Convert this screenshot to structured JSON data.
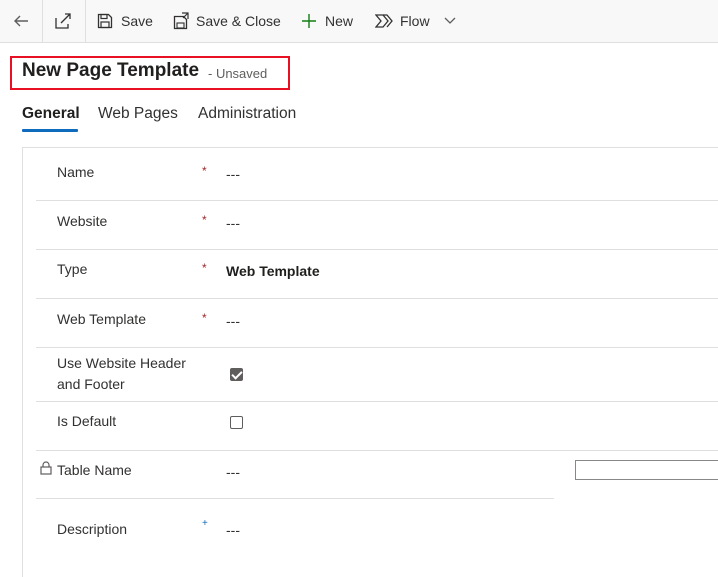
{
  "toolbar": {
    "save_label": "Save",
    "save_close_label": "Save & Close",
    "new_label": "New",
    "flow_label": "Flow"
  },
  "header": {
    "title": "New Page Template",
    "status": "- Unsaved"
  },
  "tabs": [
    {
      "label": "General",
      "active": true
    },
    {
      "label": "Web Pages",
      "active": false
    },
    {
      "label": "Administration",
      "active": false
    }
  ],
  "form": {
    "name": {
      "label": "Name",
      "required": "*",
      "value": "---"
    },
    "website": {
      "label": "Website",
      "required": "*",
      "value": "---"
    },
    "type": {
      "label": "Type",
      "required": "*",
      "value": "Web Template"
    },
    "web_template": {
      "label": "Web Template",
      "required": "*",
      "value": "---"
    },
    "use_header_footer": {
      "label_line1": "Use Website Header",
      "label_line2": "and Footer",
      "checked": true
    },
    "is_default": {
      "label": "Is Default",
      "checked": false
    },
    "table_name": {
      "label": "Table Name",
      "value": "---"
    },
    "description": {
      "label": "Description",
      "required": "+",
      "value": "---"
    }
  },
  "colors": {
    "accent": "#0f6cbd",
    "highlight_box": "#e81123",
    "required": "#a4262c",
    "new_icon": "#107c10"
  }
}
